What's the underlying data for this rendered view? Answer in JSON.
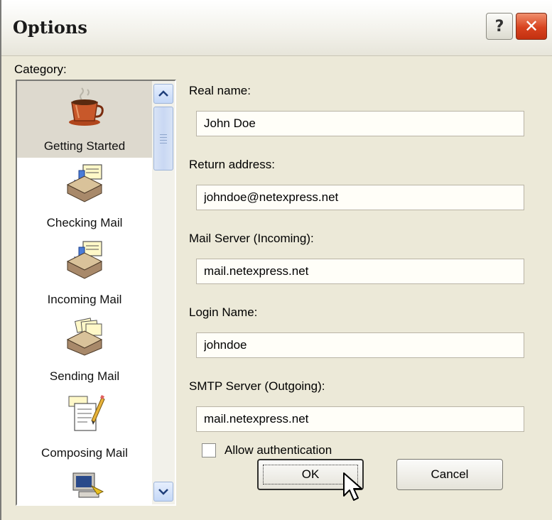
{
  "window": {
    "title": "Options",
    "help_label": "?",
    "close_label": "✕"
  },
  "category": {
    "label": "Category:",
    "items": [
      {
        "label": "Getting Started",
        "icon": "coffee-cup-icon",
        "selected": true
      },
      {
        "label": "Checking Mail",
        "icon": "mail-inbox-icon"
      },
      {
        "label": "Incoming Mail",
        "icon": "mail-inbox-icon"
      },
      {
        "label": "Sending Mail",
        "icon": "mail-outbox-icon"
      },
      {
        "label": "Composing Mail",
        "icon": "compose-document-icon"
      },
      {
        "label": "",
        "icon": "computer-icon"
      }
    ]
  },
  "form": {
    "real_name": {
      "label": "Real name:",
      "value": "John Doe"
    },
    "return_address": {
      "label": "Return address:",
      "value": "johndoe@netexpress.net"
    },
    "mail_server": {
      "label": "Mail Server (Incoming):",
      "value": "mail.netexpress.net"
    },
    "login_name": {
      "label": "Login Name:",
      "value": "johndoe"
    },
    "smtp_server": {
      "label": "SMTP Server (Outgoing):",
      "value": "mail.netexpress.net"
    },
    "allow_auth": {
      "label": "Allow authentication",
      "checked": false
    }
  },
  "buttons": {
    "ok": "OK",
    "cancel": "Cancel"
  },
  "colors": {
    "dialog_bg": "#ece9d8",
    "selected_item_bg": "#ddd9ce",
    "close_button": "#d8431f",
    "scrollbar": "#c5d8f7"
  }
}
